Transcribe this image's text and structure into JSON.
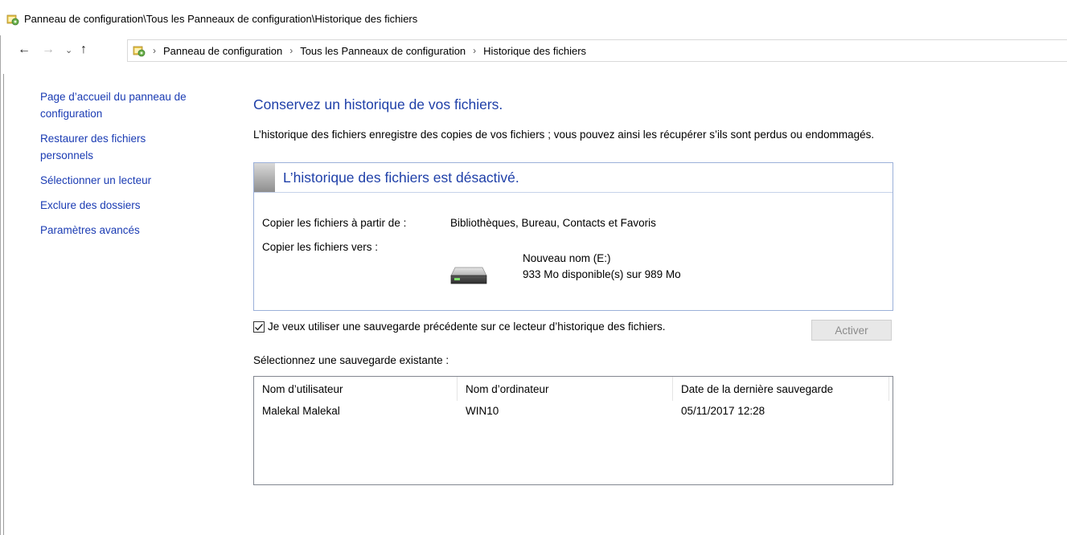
{
  "window": {
    "title": "Panneau de configuration\\Tous les Panneaux de configuration\\Historique des fichiers",
    "icon": "control-panel-icon"
  },
  "nav": {
    "back_icon": "←",
    "forward_icon": "→",
    "recent_icon": "⌄",
    "up_icon": "↑",
    "breadcrumbs": [
      "Panneau de configuration",
      "Tous les Panneaux de configuration",
      "Historique des fichiers"
    ],
    "separator": "›"
  },
  "sidebar": {
    "items": [
      {
        "label": "Page d’accueil du panneau de configuration"
      },
      {
        "label": "Restaurer des fichiers personnels"
      },
      {
        "label": "Sélectionner un lecteur"
      },
      {
        "label": "Exclure des dossiers"
      },
      {
        "label": "Paramètres avancés"
      }
    ]
  },
  "main": {
    "heading": "Conservez un historique de vos fichiers.",
    "description": "L’historique des fichiers enregistre des copies de vos fichiers ; vous pouvez ainsi les récupérer s’ils sont perdus ou endommagés.",
    "status": {
      "title": "L’historique des fichiers est désactivé.",
      "copy_from_label": "Copier les fichiers à partir de :",
      "copy_from_value": "Bibliothèques, Bureau, Contacts et Favoris",
      "copy_to_label": "Copier les fichiers vers :",
      "drive_name": "Nouveau nom (E:)",
      "drive_space": "933 Mo disponible(s) sur 989 Mo"
    },
    "checkbox": {
      "label": "Je veux utiliser une sauvegarde précédente sur ce lecteur d’historique des fichiers.",
      "checked": true
    },
    "activate_button": "Activer",
    "select_label": "Sélectionnez une sauvegarde existante :",
    "backups_table": {
      "columns": [
        "Nom d’utilisateur",
        "Nom d’ordinateur",
        "Date de la dernière sauvegarde"
      ],
      "rows": [
        [
          "Malekal Malekal",
          "WIN10",
          "05/11/2017 12:28"
        ]
      ]
    }
  },
  "colors": {
    "link": "#1a3bb3",
    "heading": "#1e3fa8",
    "box_border": "#9bb0d9"
  }
}
